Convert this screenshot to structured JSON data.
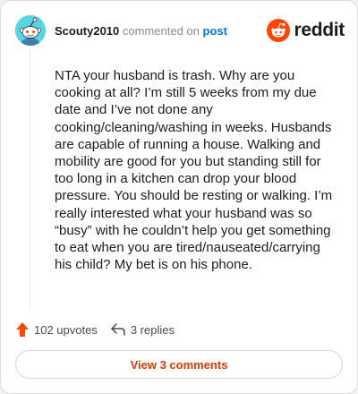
{
  "header": {
    "username": "Scouty2010",
    "action_text": "commented on",
    "target_text": "post",
    "brand_name": "reddit"
  },
  "comment": {
    "text": "NTA your husband is trash. Why are you cooking at all? I’m still 5 weeks from my due date and I’ve not done any cooking/cleaning/washing in weeks. Husbands are capable of running a house. Walking and mobility are good for you but standing still for too long in a kitchen can drop your blood pressure. You should be resting or walking. I’m really interested what your husband was so “busy” with he couldn’t help you get something to eat when you are tired/nauseated/carrying his child? My bet is on his phone."
  },
  "actions": {
    "upvotes_label": "102 upvotes",
    "replies_label": "3 replies"
  },
  "view_comments_label": "View 3 comments",
  "icons": {
    "avatar": "snoo-avatar-icon",
    "brand": "reddit-logo-icon",
    "upvote": "upvote-arrow-icon",
    "reply": "reply-arrow-icon"
  },
  "colors": {
    "brand_orange": "#ff4500",
    "link_blue": "#0079d3",
    "avatar_bg": "#59d4e4",
    "view_button_text": "#d93a00"
  }
}
